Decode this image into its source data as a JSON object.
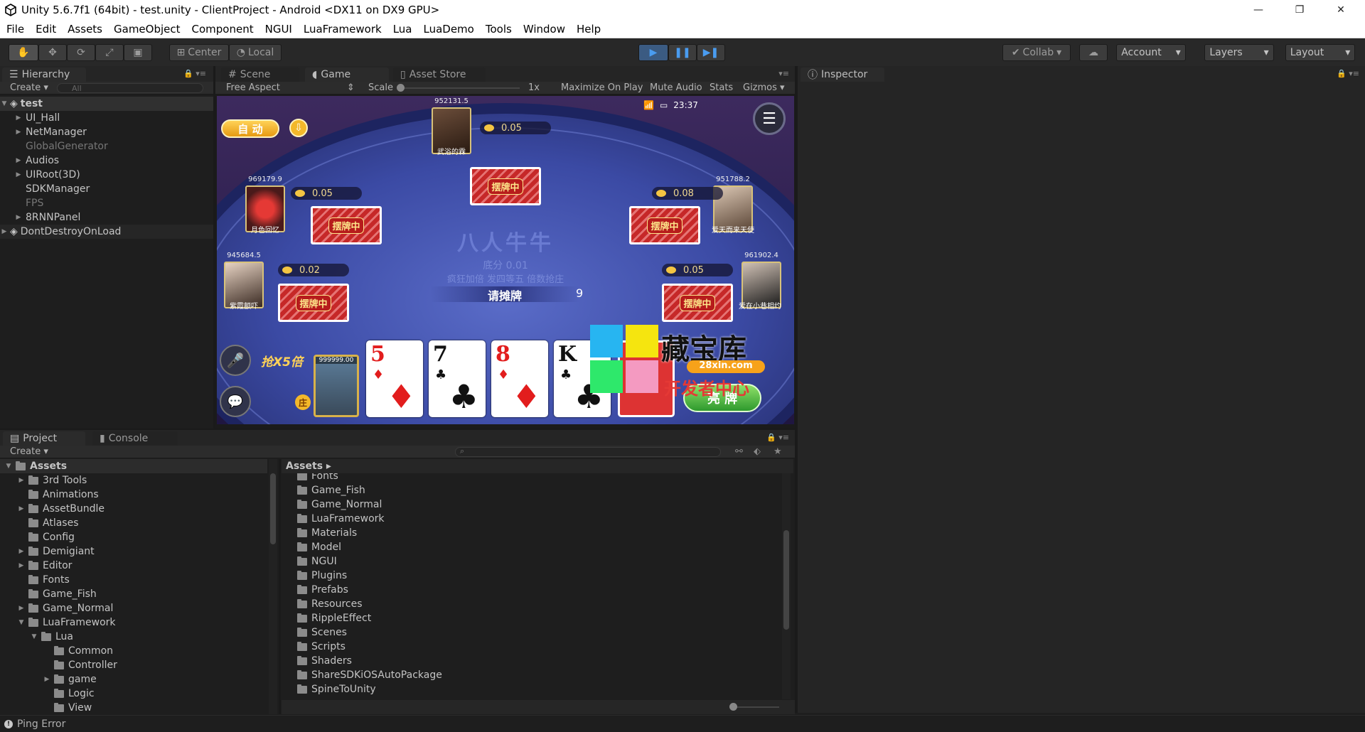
{
  "window": {
    "title": "Unity 5.6.7f1 (64bit) - test.unity - ClientProject - Android <DX11 on DX9 GPU>",
    "controls": [
      "—",
      "❐",
      "✕"
    ]
  },
  "menu": [
    "File",
    "Edit",
    "Assets",
    "GameObject",
    "Component",
    "NGUI",
    "LuaFramework",
    "Lua",
    "LuaDemo",
    "Tools",
    "Window",
    "Help"
  ],
  "toolbar": {
    "pivot": "Center",
    "space": "Local",
    "collab": "Collab",
    "account": "Account",
    "layers": "Layers",
    "layout": "Layout"
  },
  "hierarchy": {
    "tab": "Hierarchy",
    "create": "Create",
    "search_placeholder": "All",
    "scene": "test",
    "items": [
      {
        "label": "UI_Hall",
        "expandable": true,
        "dim": false
      },
      {
        "label": "NetManager",
        "expandable": true,
        "dim": false
      },
      {
        "label": "GlobalGenerator",
        "expandable": false,
        "dim": true
      },
      {
        "label": "Audios",
        "expandable": true,
        "dim": false
      },
      {
        "label": "UIRoot(3D)",
        "expandable": true,
        "dim": false
      },
      {
        "label": "SDKManager",
        "expandable": false,
        "dim": false
      },
      {
        "label": "FPS",
        "expandable": false,
        "dim": true
      },
      {
        "label": "8RNNPanel",
        "expandable": true,
        "dim": false
      }
    ],
    "dont_destroy": "DontDestroyOnLoad"
  },
  "center_tabs": {
    "scene": "Scene",
    "game": "Game",
    "asset_store": "Asset Store"
  },
  "game_toolbar": {
    "aspect": "Free Aspect",
    "scale_label": "Scale",
    "scale_value": "1x",
    "maximize": "Maximize On Play",
    "mute": "Mute Audio",
    "stats": "Stats",
    "gizmos": "Gizmos"
  },
  "game": {
    "auto_button": "自 动",
    "time": "23:37",
    "table_title": "八人牛牛",
    "base_score": "底分 0.01",
    "rules": "疯狂加倍  发四等五  倍数抢庄",
    "status": "请摊牌",
    "countdown": "9",
    "placing_label": "摆牌中",
    "grab_multiplier": "抢X5倍",
    "bank_marker": "庄",
    "self_score": "999999.00",
    "show_button": "亮 牌",
    "players": [
      {
        "score": "952131.5",
        "name": "武浴的霖",
        "bet": "0.05"
      },
      {
        "score": "969179.9",
        "name": "月色回忆",
        "bet": "0.05"
      },
      {
        "score": "951788.2",
        "name": "爱天而来天使",
        "bet": "0.08"
      },
      {
        "score": "945684.5",
        "name": "紫霞额吓",
        "bet": "0.02"
      },
      {
        "score": "961902.4",
        "name": "爱在小巷相约",
        "bet": "0.05"
      }
    ],
    "hand": [
      {
        "rank": "5",
        "suit": "♦",
        "color": "red"
      },
      {
        "rank": "7",
        "suit": "♣",
        "color": "black"
      },
      {
        "rank": "8",
        "suit": "♦",
        "color": "red"
      },
      {
        "rank": "K",
        "suit": "♣",
        "color": "black"
      }
    ],
    "watermark": {
      "cn": "藏宝库",
      "url": "28xin.com",
      "tagline": "开发者中心"
    }
  },
  "inspector": {
    "tab": "Inspector"
  },
  "project": {
    "tab": "Project",
    "console_tab": "Console",
    "create": "Create",
    "tree": [
      {
        "label": "Assets",
        "depth": 0,
        "arrow": "open",
        "bold": true
      },
      {
        "label": "3rd Tools",
        "depth": 1,
        "arrow": "closed"
      },
      {
        "label": "Animations",
        "depth": 1,
        "arrow": "none"
      },
      {
        "label": "AssetBundle",
        "depth": 1,
        "arrow": "closed"
      },
      {
        "label": "Atlases",
        "depth": 1,
        "arrow": "none"
      },
      {
        "label": "Config",
        "depth": 1,
        "arrow": "none"
      },
      {
        "label": "Demigiant",
        "depth": 1,
        "arrow": "closed"
      },
      {
        "label": "Editor",
        "depth": 1,
        "arrow": "closed"
      },
      {
        "label": "Fonts",
        "depth": 1,
        "arrow": "none"
      },
      {
        "label": "Game_Fish",
        "depth": 1,
        "arrow": "none"
      },
      {
        "label": "Game_Normal",
        "depth": 1,
        "arrow": "closed"
      },
      {
        "label": "LuaFramework",
        "depth": 1,
        "arrow": "open"
      },
      {
        "label": "Lua",
        "depth": 2,
        "arrow": "open"
      },
      {
        "label": "Common",
        "depth": 3,
        "arrow": "none"
      },
      {
        "label": "Controller",
        "depth": 3,
        "arrow": "none"
      },
      {
        "label": "game",
        "depth": 3,
        "arrow": "closed"
      },
      {
        "label": "Logic",
        "depth": 3,
        "arrow": "none"
      },
      {
        "label": "View",
        "depth": 3,
        "arrow": "none"
      }
    ],
    "breadcrumb": "Assets",
    "assets": [
      "Fonts",
      "Game_Fish",
      "Game_Normal",
      "LuaFramework",
      "Materials",
      "Model",
      "NGUI",
      "Plugins",
      "Prefabs",
      "Resources",
      "RippleEffect",
      "Scenes",
      "Scripts",
      "Shaders",
      "ShareSDKiOSAutoPackage",
      "SpineToUnity"
    ]
  },
  "status_bar": {
    "text": "Ping Error"
  },
  "colors": {
    "play_blue": "#4a9cf0",
    "editor_bg": "#1e1e1e",
    "felt": "#3a4aa0"
  }
}
